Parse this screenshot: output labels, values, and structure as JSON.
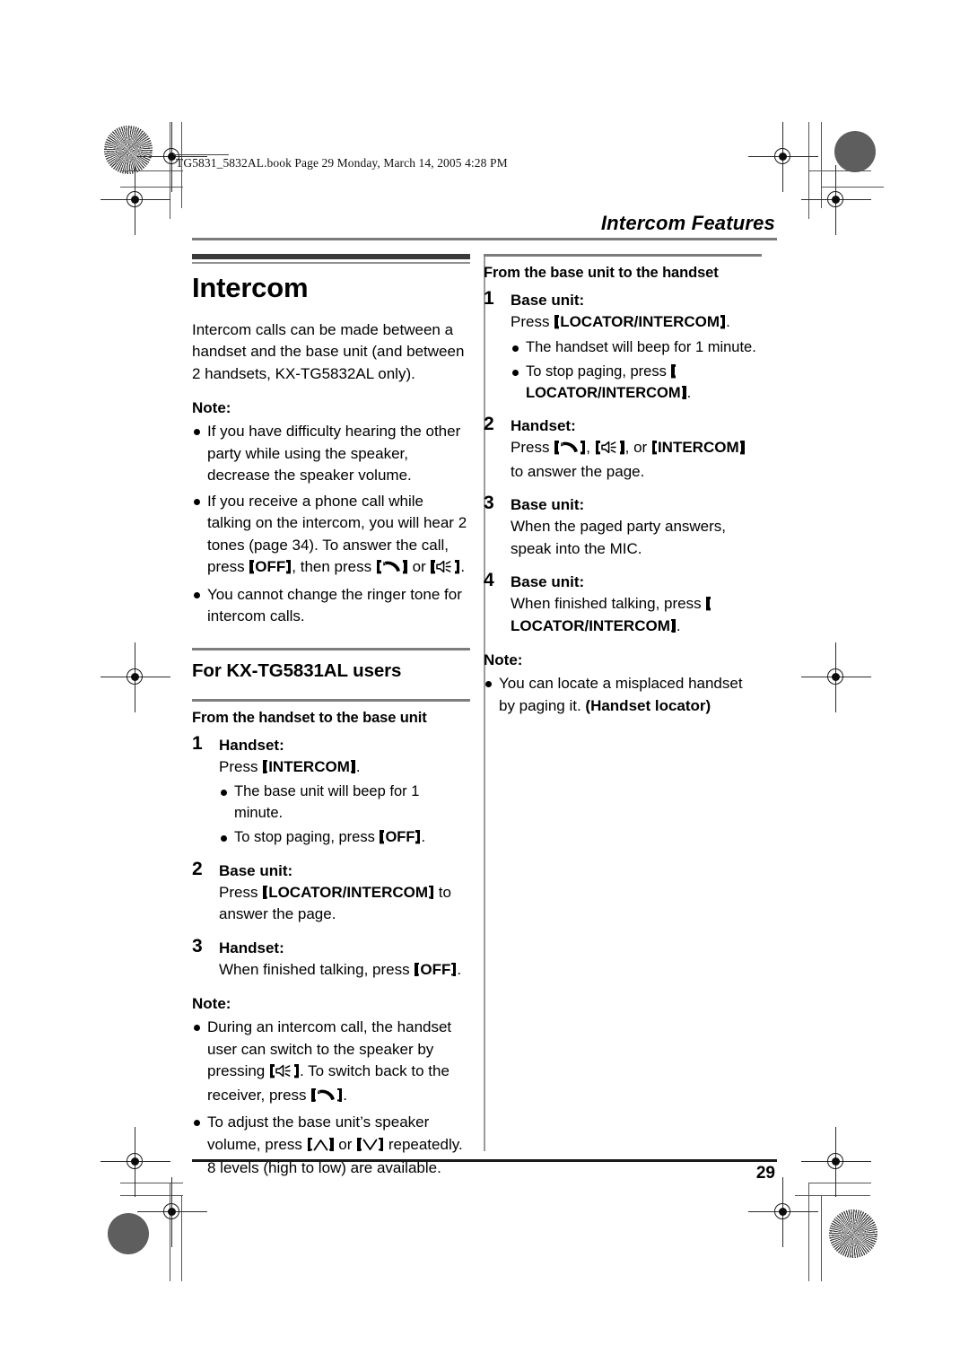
{
  "print": {
    "file_header": "TG5831_5832AL.book  Page 29  Monday, March 14, 2005  4:28 PM",
    "running_head": "Intercom Features",
    "page_number": "29"
  },
  "icons": {
    "talk": "talk-handset-icon",
    "speaker": "speakerphone-icon",
    "up": "volume-up-caret-icon",
    "down": "volume-down-caret-icon",
    "registration": "registration-target-icon",
    "density": "density-patch-icon",
    "star_target": "star-target-icon"
  },
  "left_column": {
    "title": "Intercom",
    "intro": "Intercom calls can be made between a handset and the base unit (and between 2 handsets, KX-TG5832AL only).",
    "note_label": "Note:",
    "notes": [
      {
        "parts": [
          {
            "t": "If you have difficulty hearing the other party while using the speaker, decrease the speaker volume."
          }
        ]
      },
      {
        "parts": [
          {
            "t": "If you receive a phone call while talking on the intercom, you will hear 2 tones (page 34). To answer the call, press "
          },
          {
            "key": "OFF"
          },
          {
            "t": ", then press "
          },
          {
            "keyicon": "talk"
          },
          {
            "t": " or "
          },
          {
            "keyicon": "speaker"
          },
          {
            "t": "."
          }
        ]
      },
      {
        "parts": [
          {
            "t": "You cannot change the ringer tone for intercom calls."
          }
        ]
      }
    ],
    "section_heading": "For KX-TG5831AL users",
    "sub_heading": "From the handset to the base unit",
    "steps": [
      {
        "num": "1",
        "title": "Handset:",
        "body": [
          {
            "t": "Press "
          },
          {
            "key": "INTERCOM"
          },
          {
            "t": "."
          }
        ],
        "bullets": [
          {
            "parts": [
              {
                "t": "The base unit will beep for 1 minute."
              }
            ]
          },
          {
            "parts": [
              {
                "t": "To stop paging, press "
              },
              {
                "key": "OFF"
              },
              {
                "t": "."
              }
            ]
          }
        ]
      },
      {
        "num": "2",
        "title": "Base unit:",
        "body": [
          {
            "t": "Press "
          },
          {
            "key": "LOCATOR/INTERCOM"
          },
          {
            "t": " to answer the page."
          }
        ],
        "bullets": []
      },
      {
        "num": "3",
        "title": "Handset:",
        "body": [
          {
            "t": "When finished talking, press "
          },
          {
            "key": "OFF"
          },
          {
            "t": "."
          }
        ],
        "bullets": []
      }
    ],
    "note2_label": "Note:",
    "notes2": [
      {
        "parts": [
          {
            "t": "During an intercom call, the handset user can switch to the speaker by pressing "
          },
          {
            "keyicon": "speaker"
          },
          {
            "t": ". To switch back to the receiver, press "
          },
          {
            "keyicon": "talk"
          },
          {
            "t": "."
          }
        ]
      },
      {
        "parts": [
          {
            "t": "To adjust the base unit’s speaker volume, press "
          },
          {
            "keyicon": "up"
          },
          {
            "t": " or "
          },
          {
            "keyicon": "down"
          },
          {
            "t": " repeatedly. 8 levels (high to low) are available."
          }
        ]
      }
    ]
  },
  "right_column": {
    "sub_heading": "From the base unit to the handset",
    "steps": [
      {
        "num": "1",
        "title": "Base unit:",
        "body": [
          {
            "t": "Press "
          },
          {
            "key": "LOCATOR/INTERCOM"
          },
          {
            "t": "."
          }
        ],
        "bullets": [
          {
            "parts": [
              {
                "t": "The handset will beep for 1 minute."
              }
            ]
          },
          {
            "parts": [
              {
                "t": "To stop paging, press "
              },
              {
                "key": "LOCATOR/INTERCOM"
              },
              {
                "t": "."
              }
            ]
          }
        ]
      },
      {
        "num": "2",
        "title": "Handset:",
        "body": [
          {
            "t": "Press "
          },
          {
            "keyicon": "talk"
          },
          {
            "t": ", "
          },
          {
            "keyicon": "speaker"
          },
          {
            "t": ", or "
          },
          {
            "key": "INTERCOM"
          },
          {
            "t": " to answer the page."
          }
        ],
        "bullets": []
      },
      {
        "num": "3",
        "title": "Base unit:",
        "body": [
          {
            "t": "When the paged party answers, speak into the MIC."
          }
        ],
        "bullets": []
      },
      {
        "num": "4",
        "title": "Base unit:",
        "body": [
          {
            "t": "When finished talking, press "
          },
          {
            "key": "LOCATOR/INTERCOM"
          },
          {
            "t": "."
          }
        ],
        "bullets": []
      }
    ],
    "note_label": "Note:",
    "notes": [
      {
        "parts": [
          {
            "t": "You can locate a misplaced handset by paging it. "
          },
          {
            "bold": "(Handset locator)"
          }
        ]
      }
    ]
  }
}
